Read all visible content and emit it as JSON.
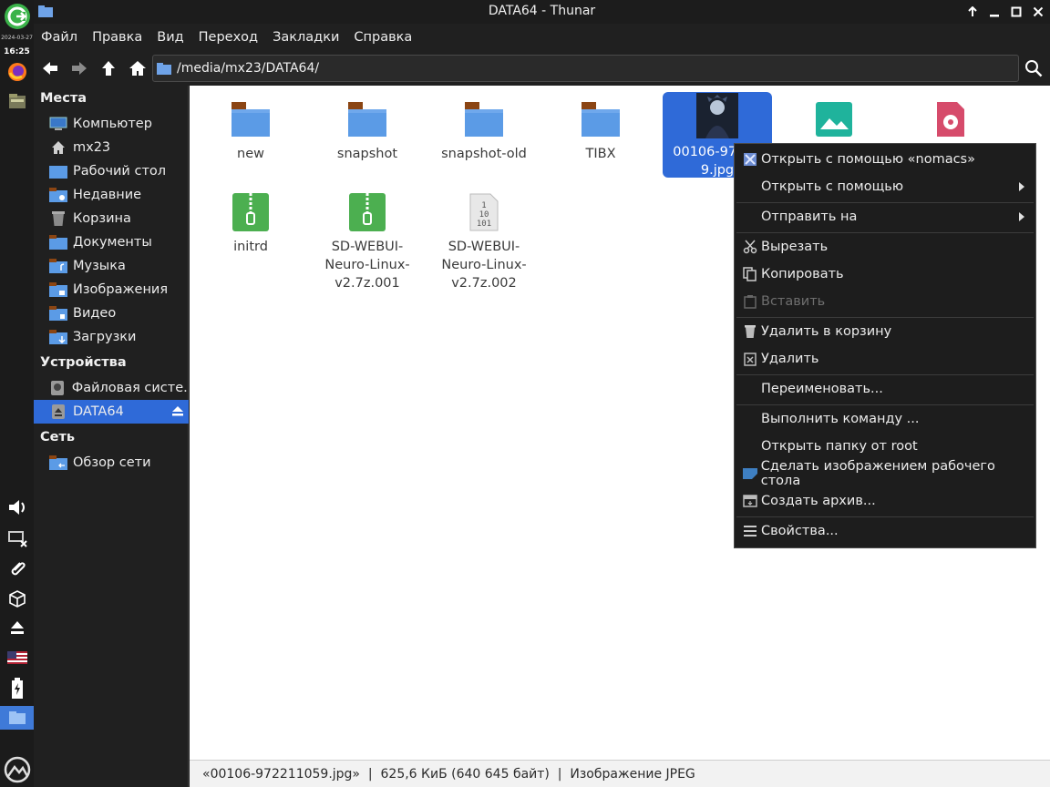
{
  "panel": {
    "date": "2024-03-27",
    "time": "16:25"
  },
  "window": {
    "title": "DATA64 - Thunar"
  },
  "menubar": [
    "Файл",
    "Правка",
    "Вид",
    "Переход",
    "Закладки",
    "Справка"
  ],
  "pathbar": {
    "path": "/media/mx23/DATA64/"
  },
  "sidebar": {
    "places_header": "Места",
    "places": [
      {
        "label": "Компьютер",
        "icon": "computer-icon"
      },
      {
        "label": "mx23",
        "icon": "home-icon"
      },
      {
        "label": "Рабочий стол",
        "icon": "desktop-folder-icon"
      },
      {
        "label": "Недавние",
        "icon": "recent-folder-icon"
      },
      {
        "label": "Корзина",
        "icon": "trash-icon"
      },
      {
        "label": "Документы",
        "icon": "documents-folder-icon"
      },
      {
        "label": "Музыка",
        "icon": "music-folder-icon"
      },
      {
        "label": "Изображения",
        "icon": "pictures-folder-icon"
      },
      {
        "label": "Видео",
        "icon": "video-folder-icon"
      },
      {
        "label": "Загрузки",
        "icon": "downloads-folder-icon"
      }
    ],
    "devices_header": "Устройства",
    "devices": [
      {
        "label": "Файловая систе...",
        "icon": "filesystem-icon"
      },
      {
        "label": "DATA64",
        "icon": "drive-icon",
        "selected": true
      }
    ],
    "network_header": "Сеть",
    "network": [
      {
        "label": "Обзор сети",
        "icon": "network-folder-icon"
      }
    ]
  },
  "files": [
    {
      "name": "new",
      "icon": "folder-icon"
    },
    {
      "name": "snapshot",
      "icon": "folder-icon"
    },
    {
      "name": "snapshot-old",
      "icon": "folder-icon"
    },
    {
      "name": "TIBX",
      "icon": "folder-icon"
    },
    {
      "name": "00106-972211059.jpg",
      "display": "00106-97221 9.jpg",
      "icon": "image-thumbnail-icon",
      "selected": true
    },
    {
      "name": "",
      "icon": "image-file-icon"
    },
    {
      "name": "",
      "icon": "disc-image-icon"
    },
    {
      "name": "initrd",
      "icon": "archive-icon"
    },
    {
      "name": "SD-WEBUI-Neuro-Linux-v2.7z.001",
      "display": "SD-WEBUI- Neuro-Linux- v2.7z.001",
      "icon": "archive-icon"
    },
    {
      "name": "SD-WEBUI-Neuro-Linux-v2.7z.002",
      "display": "SD-WEBUI- Neuro-Linux- v2.7z.002",
      "icon": "binary-file-icon"
    }
  ],
  "context_menu": [
    {
      "label": "Открыть с помощью «nomacs»",
      "icon": "nomacs-icon"
    },
    {
      "label": "Открыть с помощью",
      "submenu": true
    },
    {
      "label": "Отправить на",
      "submenu": true
    },
    {
      "label": "Вырезать",
      "icon": "cut-icon"
    },
    {
      "label": "Копировать",
      "icon": "copy-icon"
    },
    {
      "label": "Вставить",
      "icon": "paste-icon",
      "disabled": true
    },
    {
      "label": "Удалить в корзину",
      "icon": "trash-icon"
    },
    {
      "label": "Удалить",
      "icon": "delete-icon"
    },
    {
      "label": "Переименовать..."
    },
    {
      "label": "Выполнить команду ..."
    },
    {
      "label": "Открыть папку от root"
    },
    {
      "label": "Сделать изображением рабочего стола",
      "icon": "wallpaper-icon"
    },
    {
      "label": "Создать архив...",
      "icon": "archive-create-icon"
    },
    {
      "label": "Свойства...",
      "icon": "properties-icon"
    }
  ],
  "statusbar": {
    "text": "«00106-972211059.jpg»  |  625,6 КиБ (640 645 байт)  |  Изображение JPEG"
  },
  "colors": {
    "accent": "#2f6ad8",
    "folder": "#5b9be6",
    "folder_tab": "#8b4513",
    "archive": "#4caf50",
    "image_file": "#1fb39c",
    "disc_image": "#d64b6b"
  }
}
